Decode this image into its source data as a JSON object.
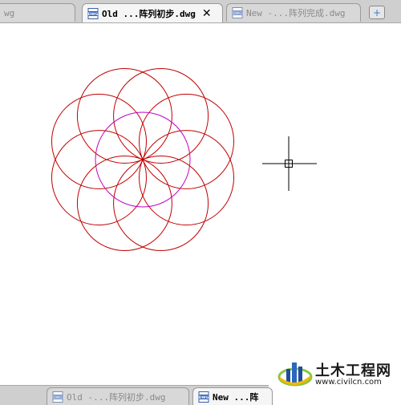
{
  "tabs_top": [
    {
      "label": "wg",
      "state": "inactive"
    },
    {
      "label": "Old ...阵列初步.dwg",
      "state": "active"
    },
    {
      "label": "New -...阵列完成.dwg",
      "state": "inactive"
    }
  ],
  "tabs_bottom": [
    {
      "label": "Old -...阵列初步.dwg",
      "state": "inactive"
    },
    {
      "label": "New ...阵",
      "state": "active"
    }
  ],
  "close_glyph": "✕",
  "new_tab_glyph": "+",
  "watermark": {
    "title": "土木工程网",
    "url": "www.civilcn.com"
  },
  "colors": {
    "petal_circles": "#c00000",
    "center_circle": "#c000c0",
    "crosshair": "#000000",
    "accent": "#3a7bd5"
  },
  "icons": {
    "file": "dwg-file-icon",
    "close": "close-icon",
    "new_tab": "new-tab-icon",
    "cursor": "crosshair-cursor-icon"
  }
}
